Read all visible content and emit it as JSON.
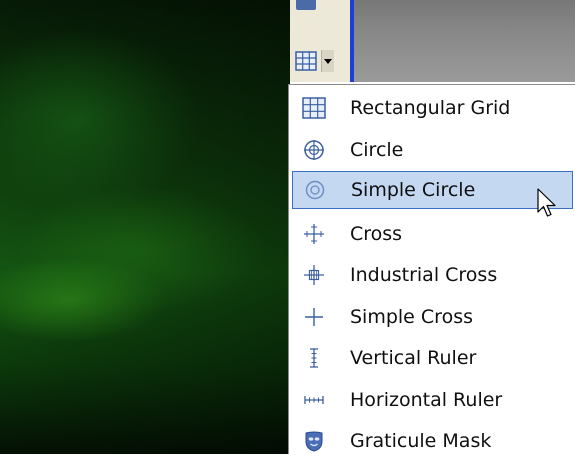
{
  "menu": {
    "items": [
      {
        "label": "Rectangular Grid",
        "icon": "rectangular-grid-icon"
      },
      {
        "label": "Circle",
        "icon": "circle-icon"
      },
      {
        "label": "Simple Circle",
        "icon": "simple-circle-icon",
        "active": true
      },
      {
        "label": "Cross",
        "icon": "cross-icon"
      },
      {
        "label": "Industrial Cross",
        "icon": "industrial-cross-icon"
      },
      {
        "label": "Simple Cross",
        "icon": "simple-cross-icon"
      },
      {
        "label": "Vertical Ruler",
        "icon": "vertical-ruler-icon"
      },
      {
        "label": "Horizontal Ruler",
        "icon": "horizontal-ruler-icon"
      },
      {
        "label": "Graticule Mask",
        "icon": "graticule-mask-icon"
      }
    ]
  },
  "colors": {
    "highlight": "#c4d8f2",
    "highlight_border": "#3b6fc4",
    "icon_blue": "#3a5fa0",
    "toolbar": "#ece9d8"
  }
}
